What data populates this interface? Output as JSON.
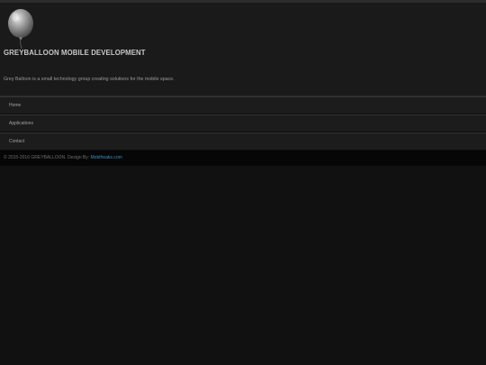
{
  "header": {
    "site_title": "GREYBALLOON MOBILE DEVELOPMENT",
    "tagline": "Grey Balloon is a small technology group creating solutions for the mobile space."
  },
  "logo": {
    "icon": "balloon-icon"
  },
  "nav": {
    "items": [
      {
        "label": "Home"
      },
      {
        "label": "Applications"
      },
      {
        "label": "Contact"
      }
    ]
  },
  "footer": {
    "copyright": "© 2015-2016 GREYBALLOON. Design By:",
    "designer_link": "Mobifreaks.com"
  },
  "colors": {
    "background": "#111111",
    "header_background": "#1a1a1a",
    "link": "#3d8fc4"
  }
}
